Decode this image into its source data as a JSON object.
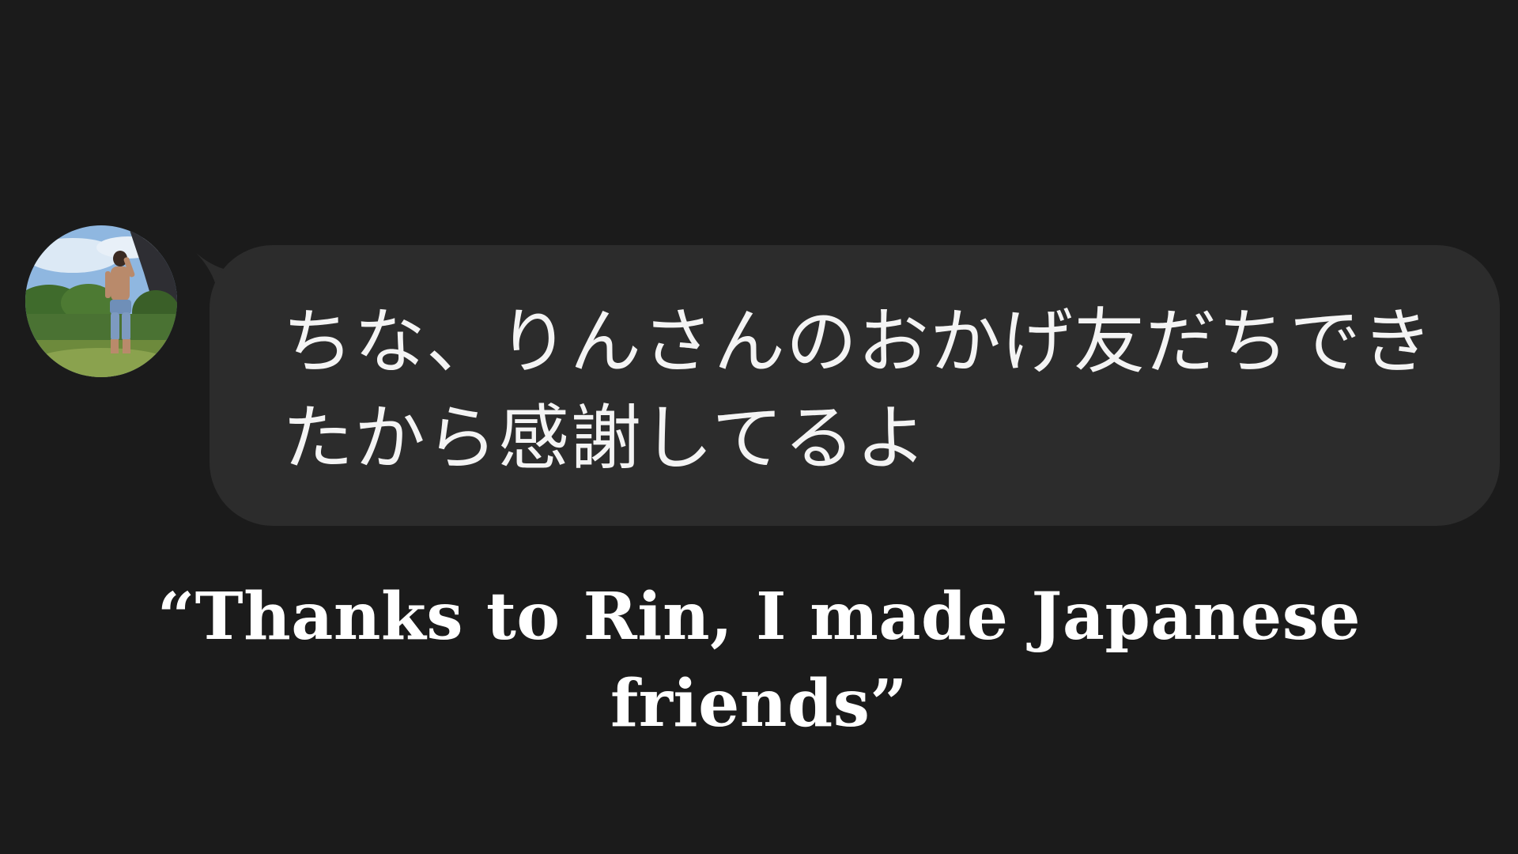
{
  "message": {
    "avatar": "profile-photo-person-outdoors",
    "text": "ちな、りんさんのおかげ友だちできたから感謝してるよ"
  },
  "caption": {
    "text": "“Thanks to Rin, I made Japanese friends”"
  },
  "colors": {
    "background": "#1b1b1b",
    "bubble": "#2c2c2c",
    "message_text": "#f4f4f4",
    "caption_text": "#ffffff"
  }
}
